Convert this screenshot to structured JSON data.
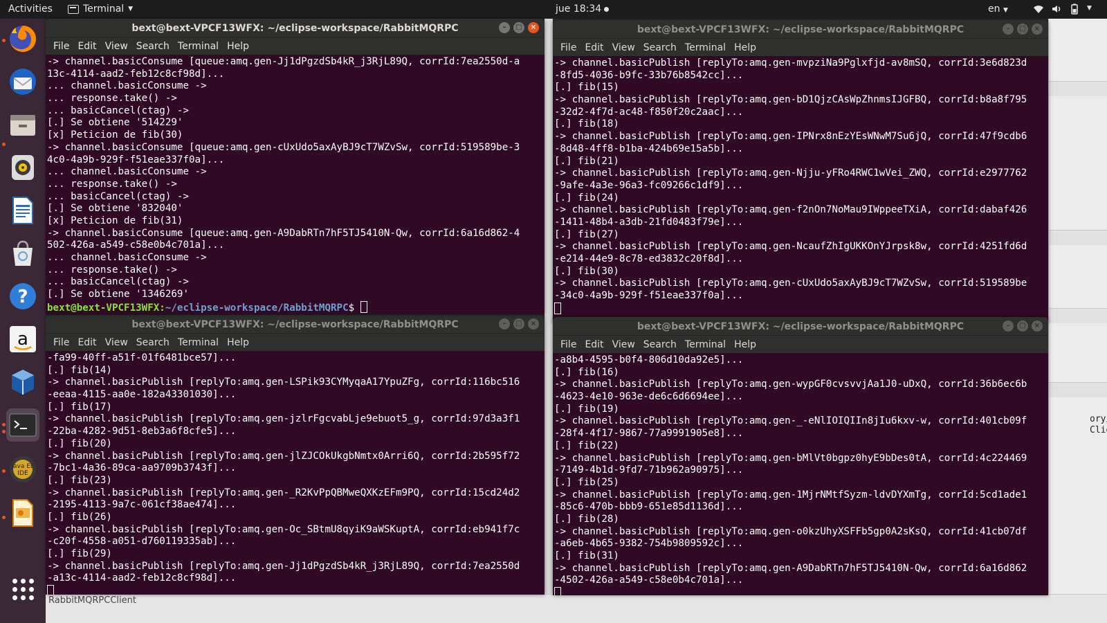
{
  "topbar": {
    "activities": "Activities",
    "app_name": "Terminal",
    "clock": "jue 18:34",
    "language": "en"
  },
  "dock": {
    "items": [
      {
        "name": "firefox-icon"
      },
      {
        "name": "thunderbird-icon"
      },
      {
        "name": "files-icon"
      },
      {
        "name": "rhythmbox-icon"
      },
      {
        "name": "libreoffice-writer-icon"
      },
      {
        "name": "ubuntu-software-icon"
      },
      {
        "name": "help-icon"
      },
      {
        "name": "amazon-icon"
      },
      {
        "name": "virtualbox-icon"
      },
      {
        "name": "terminal-icon"
      },
      {
        "name": "eclipse-javaee-icon",
        "label": "Java EE IDE"
      },
      {
        "name": "libreoffice-impress-icon"
      },
      {
        "name": "show-applications-icon"
      }
    ]
  },
  "background": {
    "status_label": "RabbitMQRPCClient",
    "eclipse_snippet": [
      "ory/com",
      "Client"
    ]
  },
  "menu_labels": [
    "File",
    "Edit",
    "View",
    "Search",
    "Terminal",
    "Help"
  ],
  "terminals": [
    {
      "id": "top-left",
      "title": "bext@bext-VPCF13WFX: ~/eclipse-workspace/RabbitMQRPC",
      "active": true,
      "lines": [
        "-> channel.basicConsume [queue:amq.gen-Jj1dPgzdSb4kR_j3RjL89Q, corrId:7ea2550d-a",
        "13c-4114-aad2-feb12c8cf98d]...",
        "... channel.basicConsume ->",
        "... response.take() ->",
        "... basicCancel(ctag) ->",
        "[.] Se obtiene '514229'",
        "[x] Peticion de fib(30)",
        "-> channel.basicConsume [queue:amq.gen-cUxUdo5axAyBJ9cT7WZvSw, corrId:519589be-3",
        "4c0-4a9b-929f-f51eae337f0a]...",
        "... channel.basicConsume ->",
        "... response.take() ->",
        "... basicCancel(ctag) ->",
        "[.] Se obtiene '832040'",
        "[x] Peticion de fib(31)",
        "-> channel.basicConsume [queue:amq.gen-A9DabRTn7hF5TJ5410N-Qw, corrId:6a16d862-4",
        "502-426a-a549-c58e0b4c701a]...",
        "... channel.basicConsume ->",
        "... response.take() ->",
        "... basicCancel(ctag) ->",
        "[.] Se obtiene '1346269'"
      ],
      "prompt_user": "bext@bext-VPCF13WFX",
      "prompt_path": "~/eclipse-workspace/RabbitMQRPC",
      "prompt_suffix": "$ "
    },
    {
      "id": "top-right",
      "title": "bext@bext-VPCF13WFX: ~/eclipse-workspace/RabbitMQRPC",
      "active": false,
      "lines": [
        "-> channel.basicPublish [replyTo:amq.gen-mvpziNa9Pglxfjd-av8mSQ, corrId:3e6d823d",
        "-8fd5-4036-b9fc-33b76b8542cc]...",
        "[.] fib(15)",
        "-> channel.basicPublish [replyTo:amq.gen-bD1QjzCAsWpZhnmsIJGFBQ, corrId:b8a8f795",
        "-32d2-4f7d-ac48-f850f20c2aac]...",
        "[.] fib(18)",
        "-> channel.basicPublish [replyTo:amq.gen-IPNrx8nEzYEsWNwM7Su6jQ, corrId:47f9cdb6",
        "-8d48-4ff8-b1ba-424b69e15a5b]...",
        "[.] fib(21)",
        "-> channel.basicPublish [replyTo:amq.gen-Njju-yFRo4RWC1wVei_ZWQ, corrId:e2977762",
        "-9afe-4a3e-96a3-fc09266c1df9]...",
        "[.] fib(24)",
        "-> channel.basicPublish [replyTo:amq.gen-f2nOn7NoMau9IWppeeTXiA, corrId:dabaf426",
        "-1411-48b4-a3db-21fd0483f79e]...",
        "[.] fib(27)",
        "-> channel.basicPublish [replyTo:amq.gen-NcaufZhIgUKKOnYJrpsk8w, corrId:4251fd6d",
        "-e214-44e9-8c78-ed3832c20f8d]...",
        "[.] fib(30)",
        "-> channel.basicPublish [replyTo:amq.gen-cUxUdo5axAyBJ9cT7WZvSw, corrId:519589be",
        "-34c0-4a9b-929f-f51eae337f0a]..."
      ]
    },
    {
      "id": "bottom-left",
      "title": "bext@bext-VPCF13WFX: ~/eclipse-workspace/RabbitMQRPC",
      "active": false,
      "lines": [
        "-fa99-40ff-a51f-01f6481bce57]...",
        "[.] fib(14)",
        "-> channel.basicPublish [replyTo:amq.gen-LSPik93CYMyqaA17YpuZFg, corrId:116bc516",
        "-eeaa-4115-aa0e-182a43301030]...",
        "[.] fib(17)",
        "-> channel.basicPublish [replyTo:amq.gen-jzlrFgcvabLje9ebuot5_g, corrId:97d3a3f1",
        "-22ba-4282-9d51-8eb3a6f8cfe5]...",
        "[.] fib(20)",
        "-> channel.basicPublish [replyTo:amq.gen-jlZJCOkUkgbNmtx0Arri6Q, corrId:2b595f72",
        "-7bc1-4a36-89ca-aa9709b3743f]...",
        "[.] fib(23)",
        "-> channel.basicPublish [replyTo:amq.gen-_R2KvPpQBMweQXKzEFm9PQ, corrId:15cd24d2",
        "-2195-4113-9a7c-061cf38ae474]...",
        "[.] fib(26)",
        "-> channel.basicPublish [replyTo:amq.gen-Oc_SBtmU8qyiK9aWSKuptA, corrId:eb941f7c",
        "-c20f-4558-a051-d760119335ab]...",
        "[.] fib(29)",
        "-> channel.basicPublish [replyTo:amq.gen-Jj1dPgzdSb4kR_j3RjL89Q, corrId:7ea2550d",
        "-a13c-4114-aad2-feb12c8cf98d]..."
      ]
    },
    {
      "id": "bottom-right",
      "title": "bext@bext-VPCF13WFX: ~/eclipse-workspace/RabbitMQRPC",
      "active": false,
      "lines": [
        "-a8b4-4595-b0f4-806d10da92e5]...",
        "[.] fib(16)",
        "-> channel.basicPublish [replyTo:amq.gen-wypGF0cvsvvjAa1J0-uDxQ, corrId:36b6ec6b",
        "-4623-4e10-963e-de6c6d6694ee]...",
        "[.] fib(19)",
        "-> channel.basicPublish [replyTo:amq.gen-_-eNlIOIQIIn8jIu6kxv-w, corrId:401cb09f",
        "-28f4-4f17-9867-77a9991905e8]...",
        "[.] fib(22)",
        "-> channel.basicPublish [replyTo:amq.gen-bMlVt0bgpz0hyE9bDes0tA, corrId:4c224469",
        "-7149-4b1d-9fd7-71b962a90975]...",
        "[.] fib(25)",
        "-> channel.basicPublish [replyTo:amq.gen-1MjrNMtfSyzm-ldvDYXmTg, corrId:5cd1ade1",
        "-85c6-470b-bbb9-651e85d1136d]...",
        "[.] fib(28)",
        "-> channel.basicPublish [replyTo:amq.gen-o0kzUhyXSFFb5gp0A2sKsQ, corrId:41cb07df",
        "-a6eb-4b65-9382-754b9809592c]...",
        "[.] fib(31)",
        "-> channel.basicPublish [replyTo:amq.gen-A9DabRTn7hF5TJ5410N-Qw, corrId:6a16d862",
        "-4502-426a-a549-c58e0b4c701a]..."
      ]
    }
  ]
}
